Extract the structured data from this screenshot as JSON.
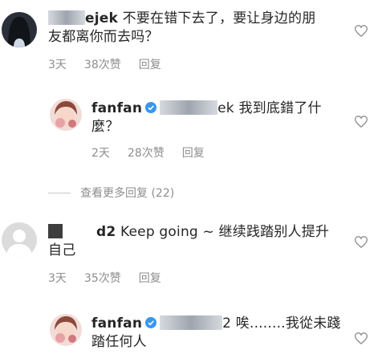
{
  "comments": [
    {
      "user_suffix": "ejek",
      "text_line1": " 不要在错下去了，要让身边的朋",
      "text_line2": "友都离你而去吗？",
      "time": "3天",
      "likes": "38次赞",
      "reply": "回复"
    },
    {
      "username": "fanfan",
      "mention_suffix": "ek",
      "text_line1": " 我到底錯了什",
      "text_line2": "麼？",
      "time": "2天",
      "likes": "28次赞",
      "reply": "回复"
    },
    {
      "user_suffix": "d2",
      "text_line1": " Keep going ~ 继续践踏别人提升",
      "text_line2": "自己",
      "time": "3天",
      "likes": "35次赞",
      "reply": "回复"
    },
    {
      "username": "fanfan",
      "mention_suffix": "2",
      "text_line1": " 唉........我從未踐",
      "text_line2": "踏任何人"
    }
  ],
  "view_more": "查看更多回复 (22)",
  "colors": {
    "verified": "#3897f0",
    "meta_gray": "#8e8e8e"
  },
  "icons": [
    "heart-icon",
    "verified-icon",
    "avatar"
  ]
}
